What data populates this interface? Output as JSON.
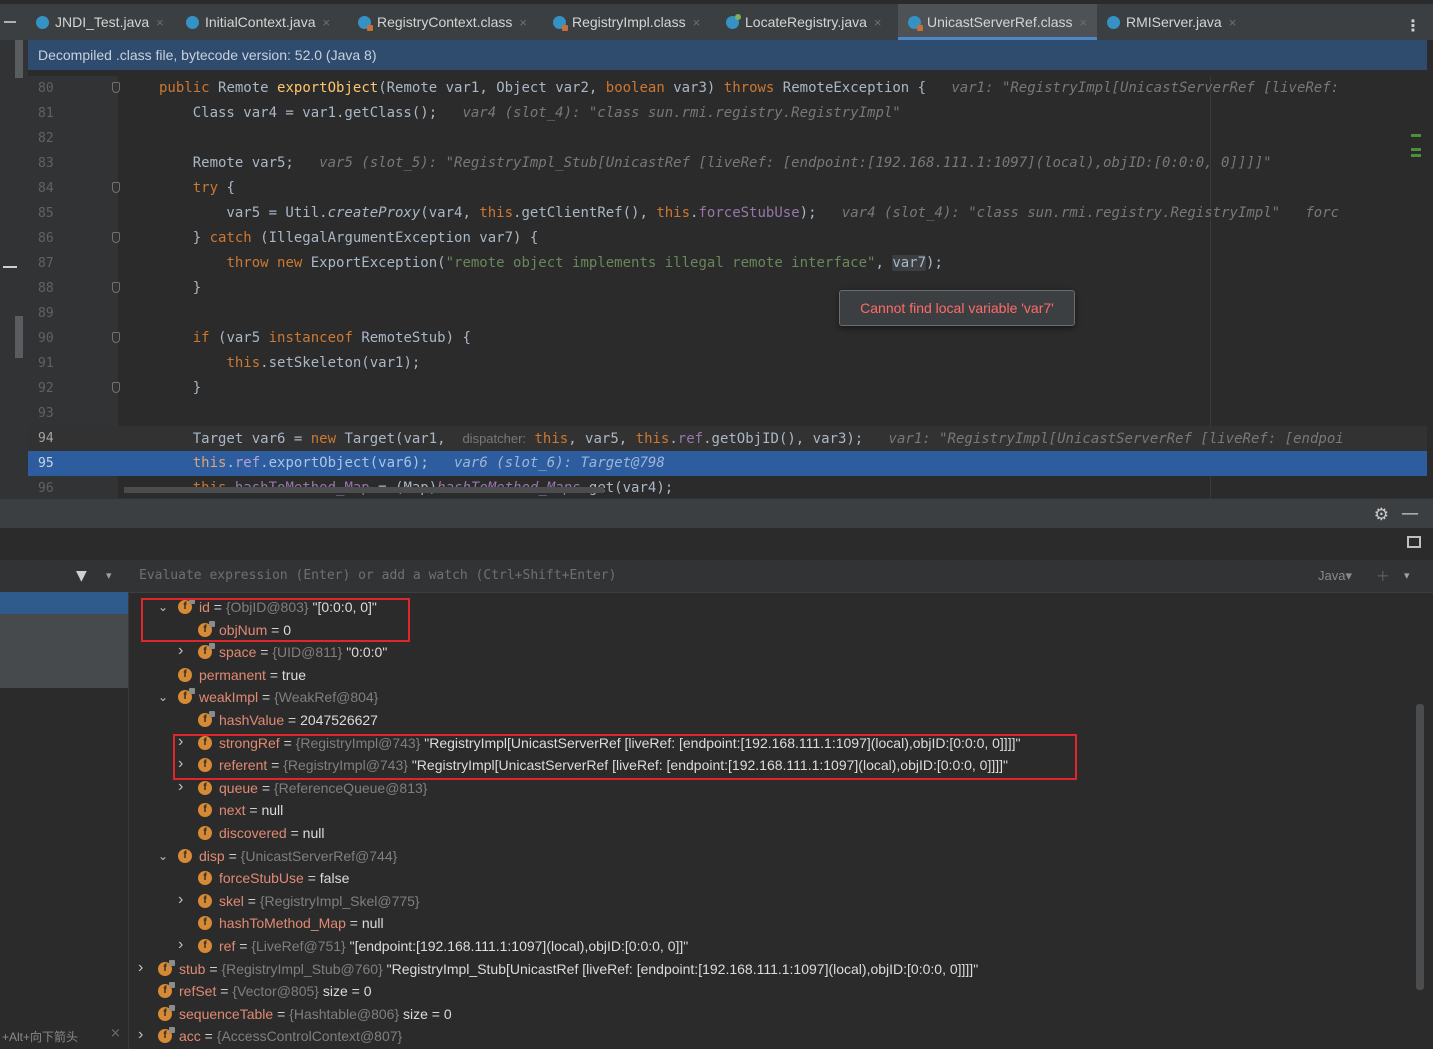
{
  "tabs": [
    {
      "label": "JNDI_Test.java",
      "icon": "class-icon"
    },
    {
      "label": "InitialContext.java",
      "icon": "class-icon"
    },
    {
      "label": "RegistryContext.class",
      "icon": "class-file-icon"
    },
    {
      "label": "RegistryImpl.class",
      "icon": "class-file-icon"
    },
    {
      "label": "LocateRegistry.java",
      "icon": "java-icon"
    },
    {
      "label": "UnicastServerRef.class",
      "icon": "class-file-icon",
      "active": true
    },
    {
      "label": "RMIServer.java",
      "icon": "class-icon"
    }
  ],
  "tab_close_glyph": "×",
  "banner": "Decompiled .class file, bytecode version: 52.0 (Java 8)",
  "editor": {
    "line_numbers": [
      "80",
      "81",
      "82",
      "83",
      "84",
      "85",
      "86",
      "87",
      "88",
      "89",
      "90",
      "91",
      "92",
      "93",
      "94",
      "95",
      "96"
    ],
    "tooltip": "Cannot find local variable 'var7'",
    "dispatcher_chip": "dispatcher:",
    "hints": {
      "l80": "var1: \"RegistryImpl[UnicastServerRef [liveRef:",
      "l81": "var4 (slot_4): \"class sun.rmi.registry.RegistryImpl\"",
      "l83": "var5 (slot_5): \"RegistryImpl_Stub[UnicastRef [liveRef: [endpoint:[192.168.111.1:1097](local),objID:[0:0:0, 0]]]]\"",
      "l85": "var4 (slot_4): \"class sun.rmi.registry.RegistryImpl\"   forc",
      "l94": "var1: \"RegistryImpl[UnicastServerRef [liveRef: [endpoi",
      "l95": "var6 (slot_6): Target@798"
    }
  },
  "debugger": {
    "eval_placeholder": "Evaluate expression (Enter) or add a watch (Ctrl+Shift+Enter)",
    "lang": "Java",
    "shortcut_hint": "+Alt+向下箭头",
    "variables": [
      {
        "name": "id",
        "ref": "{ObjID@803}",
        "value": "\"[0:0:0, 0]\"",
        "indent": 1,
        "arrow": "down",
        "lock": true
      },
      {
        "name": "objNum",
        "ref": "",
        "value": "0",
        "indent": 2,
        "arrow": "",
        "lock": true,
        "eq": true
      },
      {
        "name": "space",
        "ref": "{UID@811}",
        "value": "\"0:0:0\"",
        "indent": 2,
        "arrow": "right",
        "lock": true
      },
      {
        "name": "permanent",
        "ref": "",
        "value": "true",
        "indent": 1,
        "arrow": "",
        "lock": false,
        "eq": true
      },
      {
        "name": "weakImpl",
        "ref": "{WeakRef@804}",
        "value": "",
        "indent": 1,
        "arrow": "down",
        "lock": true
      },
      {
        "name": "hashValue",
        "ref": "",
        "value": "2047526627",
        "indent": 2,
        "arrow": "",
        "lock": true,
        "eq": true
      },
      {
        "name": "strongRef",
        "ref": "{RegistryImpl@743}",
        "value": "\"RegistryImpl[UnicastServerRef [liveRef: [endpoint:[192.168.111.1:1097](local),objID:[0:0:0, 0]]]]\"",
        "indent": 2,
        "arrow": "right",
        "lock": false
      },
      {
        "name": "referent",
        "ref": "{RegistryImpl@743}",
        "value": "\"RegistryImpl[UnicastServerRef [liveRef: [endpoint:[192.168.111.1:1097](local),objID:[0:0:0, 0]]]]\"",
        "indent": 2,
        "arrow": "right",
        "lock": false
      },
      {
        "name": "queue",
        "ref": "{ReferenceQueue@813}",
        "value": "",
        "indent": 2,
        "arrow": "right",
        "lock": false
      },
      {
        "name": "next",
        "ref": "",
        "value": "null",
        "indent": 2,
        "arrow": "",
        "lock": false,
        "eq": true
      },
      {
        "name": "discovered",
        "ref": "",
        "value": "null",
        "indent": 2,
        "arrow": "",
        "lock": false,
        "eq": true
      },
      {
        "name": "disp",
        "ref": "{UnicastServerRef@744}",
        "value": "",
        "indent": 1,
        "arrow": "down",
        "lock": false
      },
      {
        "name": "forceStubUse",
        "ref": "",
        "value": "false",
        "indent": 2,
        "arrow": "",
        "lock": false,
        "eq": true
      },
      {
        "name": "skel",
        "ref": "{RegistryImpl_Skel@775}",
        "value": "",
        "indent": 2,
        "arrow": "right",
        "lock": false
      },
      {
        "name": "hashToMethod_Map",
        "ref": "",
        "value": "null",
        "indent": 2,
        "arrow": "",
        "lock": false,
        "eq": true
      },
      {
        "name": "ref",
        "ref": "{LiveRef@751}",
        "value": "\"[endpoint:[192.168.111.1:1097](local),objID:[0:0:0, 0]]\"",
        "indent": 2,
        "arrow": "right",
        "lock": false
      },
      {
        "name": "stub",
        "ref": "{RegistryImpl_Stub@760}",
        "value": "\"RegistryImpl_Stub[UnicastRef [liveRef: [endpoint:[192.168.111.1:1097](local),objID:[0:0:0, 0]]]]\"",
        "indent": 0,
        "arrow": "right",
        "lock": true
      },
      {
        "name": "refSet",
        "ref": "{Vector@805}",
        "value": " size = 0",
        "indent": 0,
        "arrow": "",
        "lock": true
      },
      {
        "name": "sequenceTable",
        "ref": "{Hashtable@806}",
        "value": " size = 0",
        "indent": 0,
        "arrow": "",
        "lock": true
      },
      {
        "name": "acc",
        "ref": "{AccessControlContext@807}",
        "value": "",
        "indent": 0,
        "arrow": "right",
        "lock": true
      }
    ]
  },
  "colors": {
    "accent": "#4a88c7",
    "selection": "#2d5d9e",
    "highlight_box": "#e0262d",
    "field_name": "#e08a74",
    "keyword": "#cc7832"
  }
}
